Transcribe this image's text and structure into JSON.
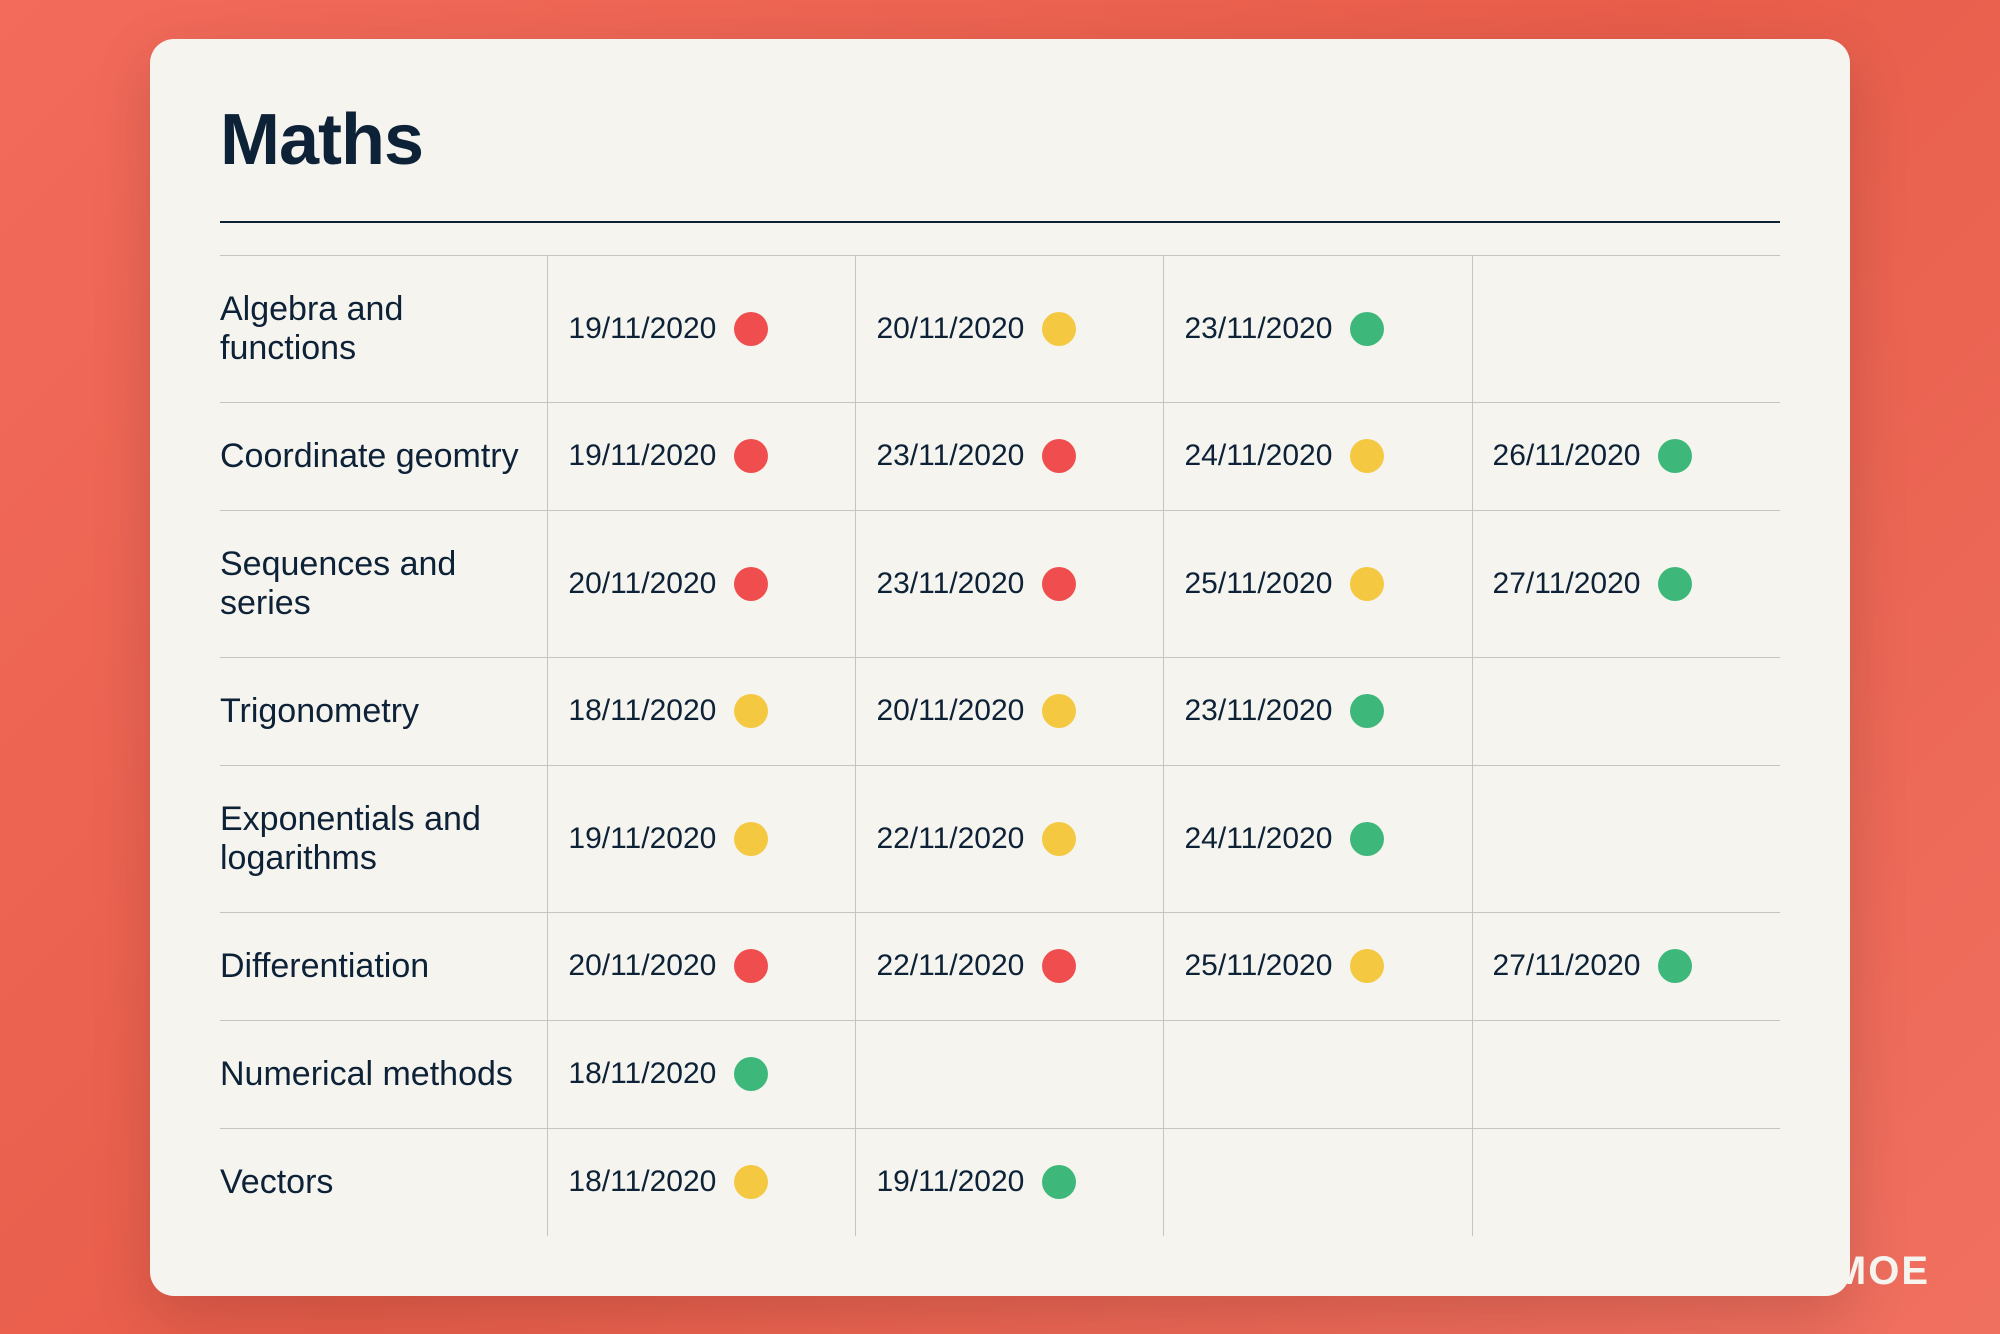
{
  "title": "Maths",
  "rows": [
    {
      "topic": "Algebra and functions",
      "entries": [
        {
          "date": "19/11/2020",
          "color": "red"
        },
        {
          "date": "20/11/2020",
          "color": "orange"
        },
        {
          "date": "23/11/2020",
          "color": "green"
        },
        {
          "date": "",
          "color": ""
        }
      ]
    },
    {
      "topic": "Coordinate geomtry",
      "entries": [
        {
          "date": "19/11/2020",
          "color": "red"
        },
        {
          "date": "23/11/2020",
          "color": "red"
        },
        {
          "date": "24/11/2020",
          "color": "orange"
        },
        {
          "date": "26/11/2020",
          "color": "green"
        }
      ]
    },
    {
      "topic": "Sequences and series",
      "entries": [
        {
          "date": "20/11/2020",
          "color": "red"
        },
        {
          "date": "23/11/2020",
          "color": "red"
        },
        {
          "date": "25/11/2020",
          "color": "orange"
        },
        {
          "date": "27/11/2020",
          "color": "green"
        }
      ]
    },
    {
      "topic": "Trigonometry",
      "entries": [
        {
          "date": "18/11/2020",
          "color": "orange"
        },
        {
          "date": "20/11/2020",
          "color": "orange"
        },
        {
          "date": "23/11/2020",
          "color": "green"
        },
        {
          "date": "",
          "color": ""
        }
      ]
    },
    {
      "topic": "Exponentials and logarithms",
      "entries": [
        {
          "date": "19/11/2020",
          "color": "orange"
        },
        {
          "date": "22/11/2020",
          "color": "orange"
        },
        {
          "date": "24/11/2020",
          "color": "green"
        },
        {
          "date": "",
          "color": ""
        }
      ]
    },
    {
      "topic": "Differentiation",
      "entries": [
        {
          "date": "20/11/2020",
          "color": "red"
        },
        {
          "date": "22/11/2020",
          "color": "red"
        },
        {
          "date": "25/11/2020",
          "color": "orange"
        },
        {
          "date": "27/11/2020",
          "color": "green"
        }
      ]
    },
    {
      "topic": "Numerical methods",
      "entries": [
        {
          "date": "18/11/2020",
          "color": "green"
        },
        {
          "date": "",
          "color": ""
        },
        {
          "date": "",
          "color": ""
        },
        {
          "date": "",
          "color": ""
        }
      ]
    },
    {
      "topic": "Vectors",
      "entries": [
        {
          "date": "18/11/2020",
          "color": "orange"
        },
        {
          "date": "19/11/2020",
          "color": "green"
        },
        {
          "date": "",
          "color": ""
        },
        {
          "date": "",
          "color": ""
        }
      ]
    }
  ],
  "logo": "JAMOE",
  "colorMap": {
    "red": "#f04e4e",
    "orange": "#f5c842",
    "green": "#3db87a"
  }
}
